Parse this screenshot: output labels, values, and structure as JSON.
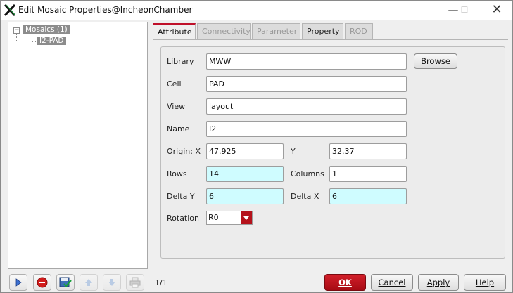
{
  "window": {
    "title": "Edit Mosaic Properties@IncheonChamber"
  },
  "tree": {
    "root_label": "Mosaics (1)",
    "child_label": "I2-PAD"
  },
  "tabs": [
    "Attribute",
    "Connectivity",
    "Parameter",
    "Property",
    "ROD"
  ],
  "form": {
    "library_label": "Library",
    "library_value": "MWW",
    "browse_label": "Browse",
    "cell_label": "Cell",
    "cell_value": "PAD",
    "view_label": "View",
    "view_value": "layout",
    "name_label": "Name",
    "name_value": "I2",
    "origin_label": "Origin:  X",
    "origin_x_value": "47.925",
    "y_label": "Y",
    "origin_y_value": "32.37",
    "rows_label": "Rows",
    "rows_value": "14",
    "columns_label": "Columns",
    "columns_value": "1",
    "delta_y_label": "Delta Y",
    "delta_y_value": "6",
    "delta_x_label": "Delta X",
    "delta_x_value": "6",
    "rotation_label": "Rotation",
    "rotation_value": "R0"
  },
  "footer": {
    "page_counter": "1/1",
    "ok_label": "OK",
    "cancel_label": "Cancel",
    "apply_label": "Apply",
    "help_label": "Help"
  },
  "colors": {
    "accent": "#c0102a",
    "highlight_field": "#cffcff",
    "tree_selection": "#8c8c8c"
  },
  "icons": [
    "app-logo-icon",
    "minimize-icon",
    "maximize-icon",
    "close-icon",
    "next-icon",
    "stop-icon",
    "save-check-icon",
    "move-up-icon",
    "move-down-icon",
    "print-icon",
    "tree-collapse-icon",
    "dropdown-arrow-icon"
  ]
}
